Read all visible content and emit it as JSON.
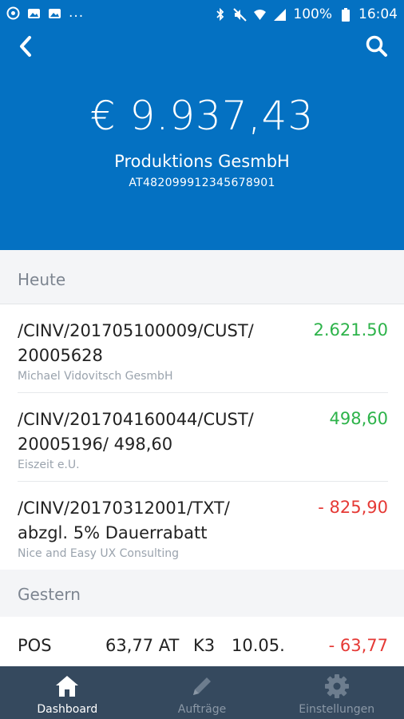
{
  "status_bar": {
    "battery": "100%",
    "time": "16:04",
    "overflow": "..."
  },
  "header": {
    "balance": "€ 9.937,43",
    "account_name": "Produktions GesmbH",
    "iban": "AT482099912345678901"
  },
  "sections": [
    {
      "title": "Heute",
      "transactions": [
        {
          "line1": "/CINV/201705100009/CUST/",
          "line2": "20005628",
          "counterparty": "Michael Vidovitsch GesmbH",
          "amount": "2.621.50"
        },
        {
          "line1": "/CINV/201704160044/CUST/",
          "line2": "20005196/ 498,60",
          "counterparty": "Eiszeit e.U.",
          "amount": "498,60"
        },
        {
          "line1": "/CINV/20170312001/TXT/",
          "line2": "abzgl. 5% Dauerrabatt",
          "counterparty": "Nice and Easy UX Consulting",
          "amount": "- 825,90"
        }
      ]
    },
    {
      "title": "Gestern",
      "transactions": [
        {
          "col1": "POS",
          "col2": "63,77 AT",
          "col3": "K3",
          "col4": "10.05.",
          "amount": "- 63,77"
        }
      ]
    }
  ],
  "tabs": [
    {
      "label": "Dashboard",
      "icon": "home-icon",
      "active": true
    },
    {
      "label": "Aufträge",
      "icon": "pencil-icon",
      "active": false
    },
    {
      "label": "Einstellungen",
      "icon": "gear-icon",
      "active": false
    }
  ],
  "colors": {
    "header_bg": "#0471c2",
    "positive": "#2db34a",
    "negative": "#e53935",
    "tabbar_bg": "#35495e"
  }
}
